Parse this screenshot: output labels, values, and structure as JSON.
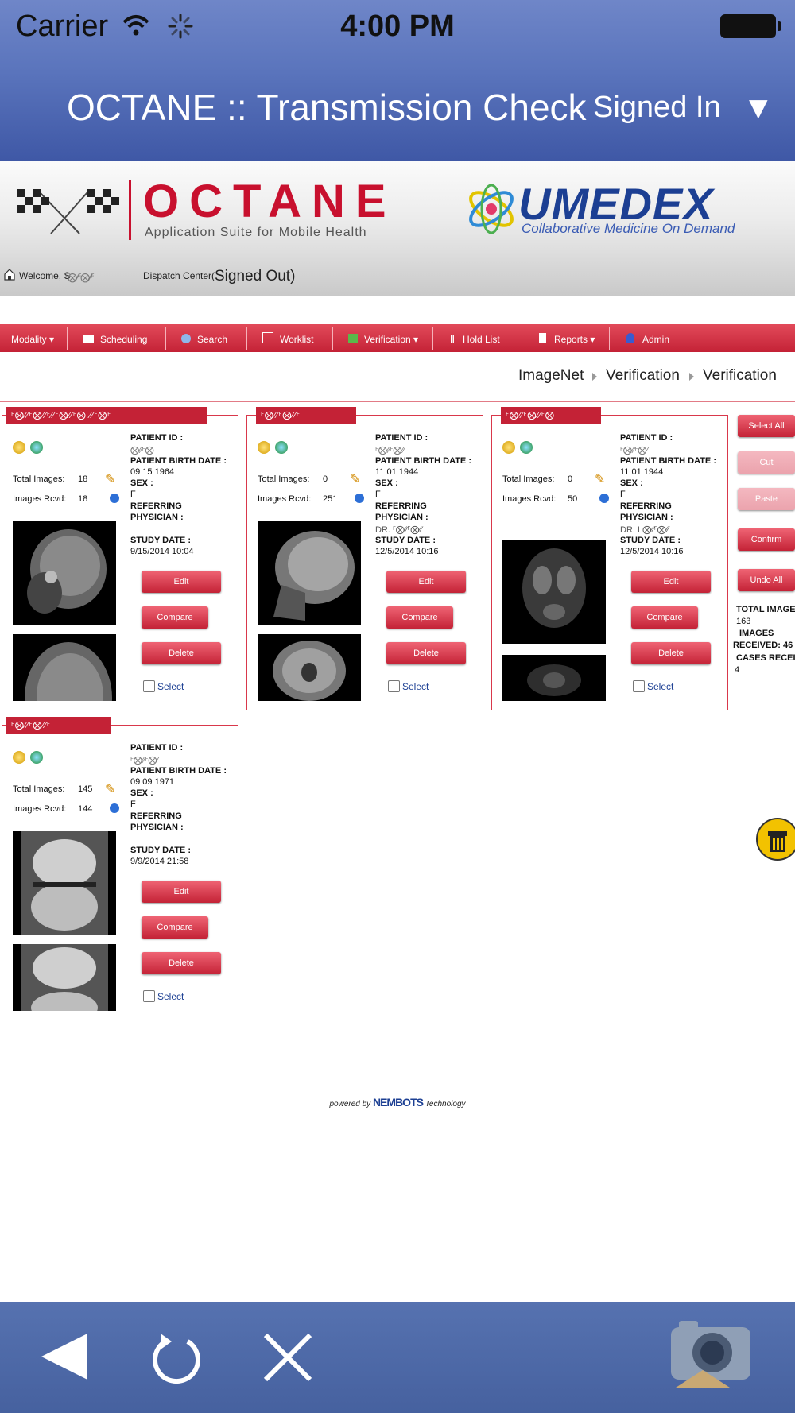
{
  "status_bar": {
    "carrier": "Carrier",
    "time": "4:00 PM"
  },
  "nav": {
    "title": "OCTANE :: Transmission Check",
    "signed_in": "Signed In",
    "signed_in_arrow": "▼"
  },
  "banner": {
    "octane_logo": "OCTANE",
    "octane_tagline": "Application Suite for Mobile Health",
    "umedex_logo": "UMEDEX",
    "umedex_tagline": "Collaborative Medicine On Demand"
  },
  "welcome": {
    "prefix": "Welcome, S",
    "user_obscured": "ꟳ⨂∕∕ꟳ⨂∕∕ꟳ",
    "center": "Dispatch Center(",
    "signed_out": "Signed Out)"
  },
  "menu": [
    {
      "label": "Modality ▾",
      "icon": "none"
    },
    {
      "label": "Scheduling",
      "icon": "scheduling-icon"
    },
    {
      "label": "Search",
      "icon": "search-icon"
    },
    {
      "label": "Worklist",
      "icon": "worklist-icon"
    },
    {
      "label": "Verification ▾",
      "icon": "verification-icon"
    },
    {
      "label": "Hold List",
      "icon": "pause-icon"
    },
    {
      "label": "Reports ▾",
      "icon": "reports-icon"
    },
    {
      "label": "Admin",
      "icon": "admin-icon"
    }
  ],
  "breadcrumb": [
    "ImageNet",
    "Verification",
    "Verification"
  ],
  "cards": [
    {
      "name_obscured": "ꟳ⨂∕∕ꟳ⨂∕∕ꟳ∕∕ꟳ⨂∕∕ꟳ⨂ ∕∕ꟳ⨂ꟳ",
      "patient_id_label": "PATIENT ID :",
      "patient_id": "⨂∕∕ꟳ⨂",
      "birth_label": "PATIENT BIRTH DATE :",
      "birth": "09 15 1964",
      "sex_label": "SEX :",
      "sex": "F",
      "referring_label": "REFERRING",
      "physician_label": "PHYSICIAN :",
      "physician": "",
      "study_label": "STUDY DATE :",
      "study_date": "9/15/2014 10:04",
      "total_label": "Total Images:",
      "total": "18",
      "rcvd_label": "Images Rcvd:",
      "rcvd": "18",
      "edit": "Edit",
      "compare": "Compare",
      "delete": "Delete",
      "select": "Select"
    },
    {
      "name_obscured": "ꟳ⨂∕∕ꟳ⨂∕∕ꟳ",
      "patient_id_label": "PATIENT ID :",
      "patient_id": "ꟳ⨂∕∕ꟳ⨂∕∕",
      "birth_label": "PATIENT BIRTH DATE :",
      "birth": "11 01 1944",
      "sex_label": "SEX :",
      "sex": "F",
      "referring_label": "REFERRING",
      "physician_label": "PHYSICIAN :",
      "physician": "DR. ꟳ⨂∕∕ꟳ⨂∕∕",
      "study_label": "STUDY DATE :",
      "study_date": "12/5/2014 10:16",
      "total_label": "Total Images:",
      "total": "0",
      "rcvd_label": "Images Rcvd:",
      "rcvd": "251",
      "edit": "Edit",
      "compare": "Compare",
      "delete": "Delete",
      "select": "Select"
    },
    {
      "name_obscured": "ꟳ⨂∕∕ꟳ⨂∕∕ꟳ⨂",
      "patient_id_label": "PATIENT ID :",
      "patient_id": "ꟳ⨂∕∕ꟳ⨂∕",
      "birth_label": "PATIENT BIRTH DATE :",
      "birth": "11 01 1944",
      "sex_label": "SEX :",
      "sex": "F",
      "referring_label": "REFERRING",
      "physician_label": "PHYSICIAN :",
      "physician": "DR. L⨂∕∕ꟳ⨂∕∕",
      "study_label": "STUDY DATE :",
      "study_date": "12/5/2014 10:16",
      "total_label": "Total Images:",
      "total": "0",
      "rcvd_label": "Images Rcvd:",
      "rcvd": "50",
      "edit": "Edit",
      "compare": "Compare",
      "delete": "Delete",
      "select": "Select"
    },
    {
      "name_obscured": "ꟳ⨂∕∕ꟳ⨂∕∕ꟳ",
      "patient_id_label": "PATIENT ID :",
      "patient_id": "ꟳ⨂∕∕ꟳ⨂∕",
      "birth_label": "PATIENT BIRTH DATE :",
      "birth": "09 09 1971",
      "sex_label": "SEX :",
      "sex": "F",
      "referring_label": "REFERRING",
      "physician_label": "PHYSICIAN :",
      "physician": "",
      "study_label": "STUDY DATE :",
      "study_date": "9/9/2014 21:58",
      "total_label": "Total Images:",
      "total": "145",
      "rcvd_label": "Images Rcvd:",
      "rcvd": "144",
      "edit": "Edit",
      "compare": "Compare",
      "delete": "Delete",
      "select": "Select"
    }
  ],
  "right_panel": {
    "select_all": "Select All",
    "cut": "Cut",
    "paste": "Paste",
    "confirm": "Confirm",
    "undo_all": "Undo All",
    "total_images_label": "TOTAL IMAGE",
    "total_images": "163",
    "images_received_label_1": "IMAGES",
    "images_received_label_2": "RECEIVED: 46",
    "cases_label": "CASES RECEI",
    "cases": "4"
  },
  "footer": {
    "powered_prefix": "powered by",
    "powered_brand": "NEMBOTS",
    "powered_suffix": "Technology"
  },
  "toolbar": {
    "back": "back-icon",
    "refresh": "refresh-icon",
    "close": "close-icon",
    "camera": "camera-icon"
  },
  "colors": {
    "nav_blue": "#4a64ad",
    "brand_red": "#c42236",
    "umedex_blue": "#1c3f93"
  }
}
